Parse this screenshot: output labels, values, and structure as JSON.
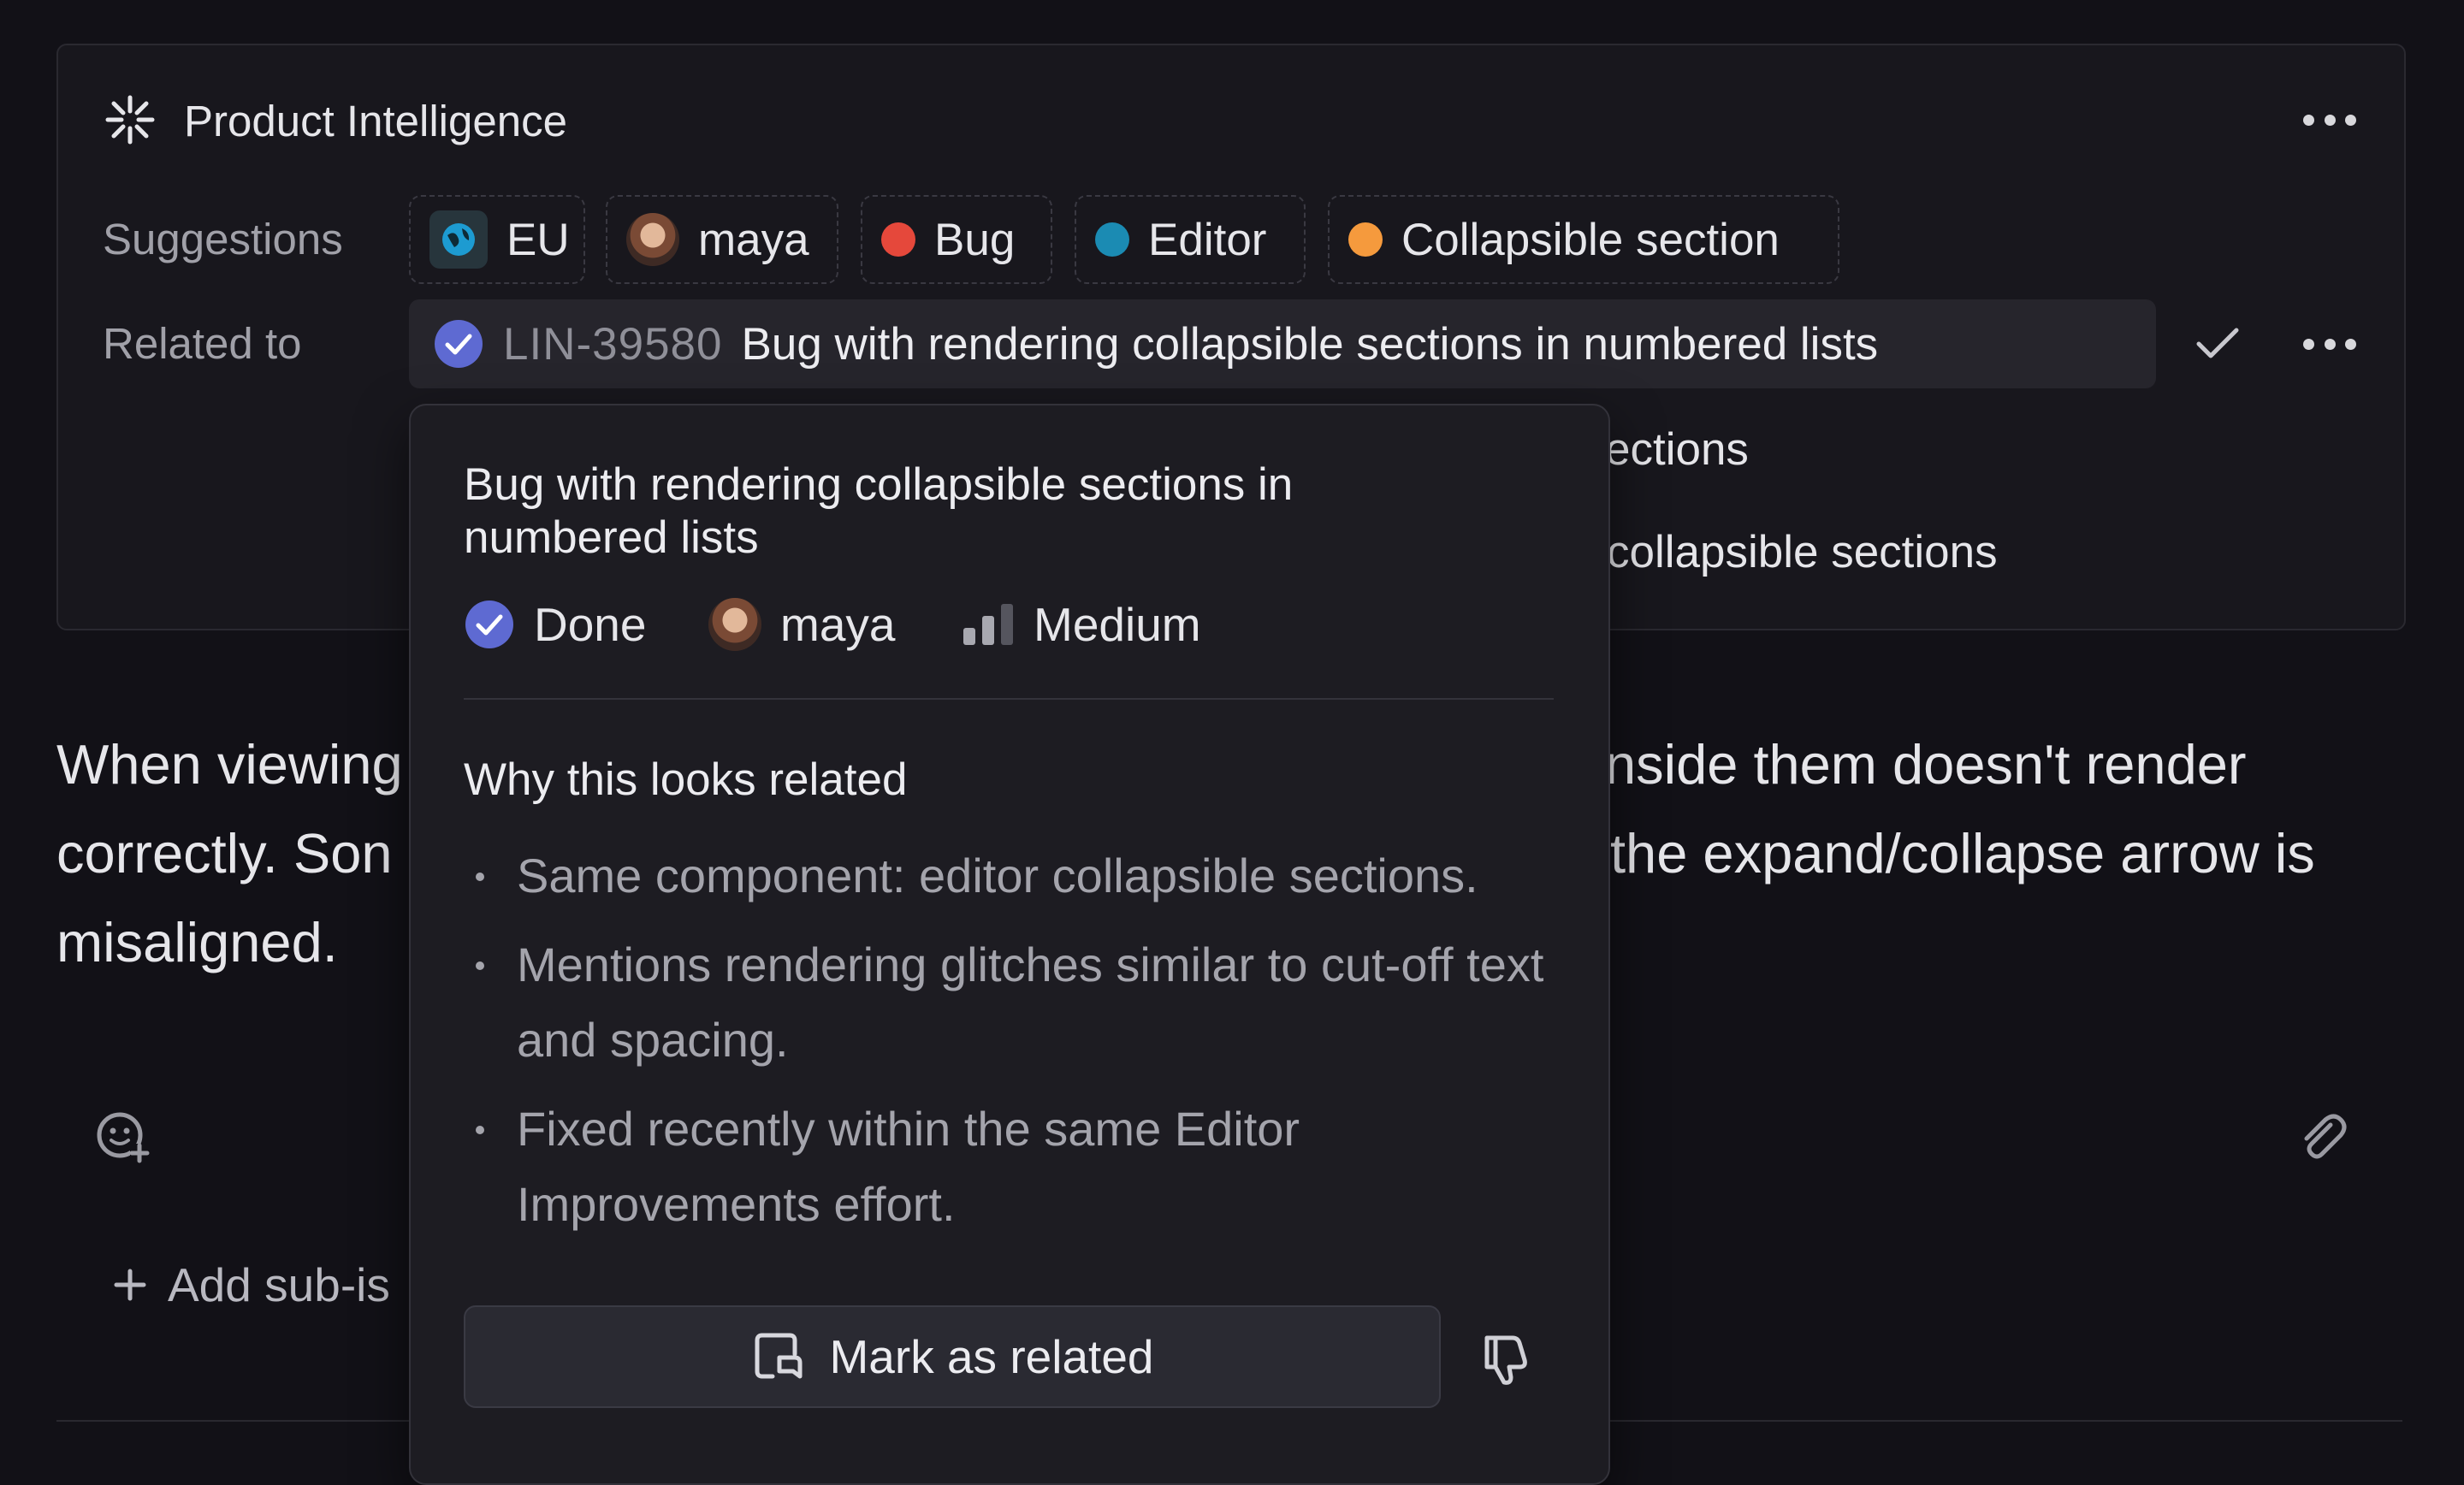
{
  "panel": {
    "title": "Product Intelligence",
    "suggestions_label": "Suggestions",
    "related_label": "Related to",
    "chips": [
      {
        "label": "EU",
        "kind": "team-icon"
      },
      {
        "label": "maya",
        "kind": "avatar"
      },
      {
        "label": "Bug",
        "kind": "dot",
        "color": "#e5483b"
      },
      {
        "label": "Editor",
        "kind": "dot",
        "color": "#1b8bb3"
      },
      {
        "label": "Collapsible section",
        "kind": "dot",
        "color": "#f59a3d"
      }
    ],
    "related_issue": {
      "id": "LIN-39580",
      "title": "Bug with rendering collapsible sections in numbered lists"
    },
    "behind_text_1": "ections",
    "behind_text_2": "collapsible sections"
  },
  "body": {
    "line1_left": "When viewing",
    "line1_right": "nside them doesn't render",
    "line2_left": "correctly. Son",
    "line2_right": "the expand/collapse arrow is",
    "line3": "misaligned.",
    "add_sub_issue": "Add sub-is"
  },
  "popover": {
    "title": "Bug with rendering collapsible sections in numbered lists",
    "status": "Done",
    "assignee": "maya",
    "priority": "Medium",
    "why_heading": "Why this looks related",
    "reasons": [
      "Same component: editor collapsible sections.",
      "Mentions rendering glitches similar to cut-off text and spacing.",
      "Fixed recently within the same Editor Improvements effort."
    ],
    "mark_button": "Mark as related"
  },
  "colors": {
    "accent": "#5e6ad2",
    "background": "#121117",
    "panel": "#18171d"
  }
}
